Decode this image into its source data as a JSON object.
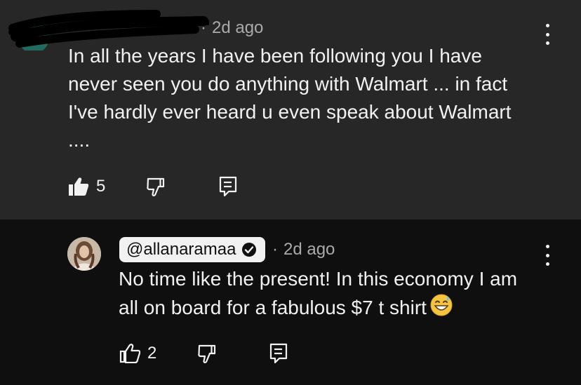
{
  "top_comment": {
    "username": "",
    "timestamp": "2d ago",
    "text": "In all the years I have been following you I have\nnever seen you do anything with Walmart ... in fact\nI've hardly ever heard u even speak about Walmart\n....",
    "likes": "5",
    "icons": {
      "like": "thumbs-up-filled-icon",
      "dislike": "thumbs-down-icon",
      "reply": "reply-icon",
      "menu": "more-vertical-icon"
    }
  },
  "reply_comment": {
    "handle": "@allanaramaa",
    "verified": true,
    "timestamp": "2d ago",
    "text": "No time like the present! In this economy I am\nall on board for a fabulous $7 t shirt",
    "emoji": "grinning-sweat-emoji",
    "likes": "2",
    "icons": {
      "like": "thumbs-up-outline-icon",
      "dislike": "thumbs-down-icon",
      "reply": "reply-icon",
      "menu": "more-vertical-icon"
    }
  },
  "colors": {
    "top_background": "#272727",
    "reply_background": "#0f0f0f",
    "primary_text": "#f1f1f1",
    "secondary_text": "#aaaaaa"
  }
}
